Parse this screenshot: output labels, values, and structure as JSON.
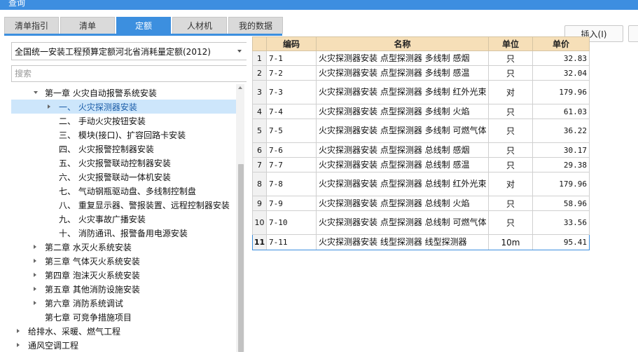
{
  "window": {
    "title": "查询"
  },
  "tabs": [
    {
      "label": "清单指引",
      "active": false
    },
    {
      "label": "清单",
      "active": false
    },
    {
      "label": "定额",
      "active": true
    },
    {
      "label": "人材机",
      "active": false
    },
    {
      "label": "我的数据",
      "active": false
    }
  ],
  "toolbar": {
    "insert_label": "插入(I)"
  },
  "left": {
    "quota_db": "全国统一安装工程预算定额河北省消耗量定额(2012)",
    "search_placeholder": "搜索",
    "tree": [
      {
        "label": "第一章  火灾自动报警系统安装",
        "level": 1,
        "arrow": "down",
        "selected": false
      },
      {
        "label": "一、 火灾探测器安装",
        "level": 2,
        "arrow": "right",
        "selected": true
      },
      {
        "label": "二、 手动火灾按钮安装",
        "level": 2,
        "arrow": "none",
        "selected": false
      },
      {
        "label": "三、 模块(接口)、扩容回路卡安装",
        "level": 2,
        "arrow": "none",
        "selected": false
      },
      {
        "label": "四、 火灾报警控制器安装",
        "level": 2,
        "arrow": "none",
        "selected": false
      },
      {
        "label": "五、 火灾报警联动控制器安装",
        "level": 2,
        "arrow": "none",
        "selected": false
      },
      {
        "label": "六、 火灾报警联动一体机安装",
        "level": 2,
        "arrow": "none",
        "selected": false
      },
      {
        "label": "七、 气动钢瓶驱动盘、多线制控制盘",
        "level": 2,
        "arrow": "none",
        "selected": false
      },
      {
        "label": "八、 重复显示器、警报装置、远程控制器安装",
        "level": 2,
        "arrow": "none",
        "selected": false
      },
      {
        "label": "九、 火灾事故广播安装",
        "level": 2,
        "arrow": "none",
        "selected": false
      },
      {
        "label": "十、 消防通讯、报警备用电源安装",
        "level": 2,
        "arrow": "none",
        "selected": false
      },
      {
        "label": "第二章  水灭火系统安装",
        "level": 1,
        "arrow": "right",
        "selected": false
      },
      {
        "label": "第三章  气体灭火系统安装",
        "level": 1,
        "arrow": "right",
        "selected": false
      },
      {
        "label": "第四章  泡沫灭火系统安装",
        "level": 1,
        "arrow": "right",
        "selected": false
      },
      {
        "label": "第五章  其他消防设施安装",
        "level": 1,
        "arrow": "right",
        "selected": false
      },
      {
        "label": "第六章  消防系统调试",
        "level": 1,
        "arrow": "right",
        "selected": false
      },
      {
        "label": "第七章  可竞争措施项目",
        "level": 1,
        "arrow": "none",
        "selected": false
      },
      {
        "label": "给排水、采暖、燃气工程",
        "level": 0,
        "arrow": "right",
        "selected": false
      },
      {
        "label": "通风空调工程",
        "level": 0,
        "arrow": "right",
        "selected": false
      }
    ]
  },
  "grid": {
    "headers": [
      "编码",
      "名称",
      "单位",
      "单价"
    ],
    "rows": [
      {
        "idx": "1",
        "code": "7-1",
        "name": "火灾探测器安装 点型探测器 多线制 感烟",
        "unit": "只",
        "price": "32.83",
        "selected": false
      },
      {
        "idx": "2",
        "code": "7-2",
        "name": "火灾探测器安装 点型探测器 多线制 感温",
        "unit": "只",
        "price": "32.04",
        "selected": false
      },
      {
        "idx": "3",
        "code": "7-3",
        "name": "火灾探测器安装 点型探测器 多线制 红外光束",
        "unit": "对",
        "price": "179.96",
        "selected": false
      },
      {
        "idx": "4",
        "code": "7-4",
        "name": "火灾探测器安装 点型探测器 多线制 火焰",
        "unit": "只",
        "price": "61.03",
        "selected": false
      },
      {
        "idx": "5",
        "code": "7-5",
        "name": "火灾探测器安装 点型探测器 多线制 可燃气体",
        "unit": "只",
        "price": "36.22",
        "selected": false
      },
      {
        "idx": "6",
        "code": "7-6",
        "name": "火灾探测器安装 点型探测器 总线制 感烟",
        "unit": "只",
        "price": "30.17",
        "selected": false
      },
      {
        "idx": "7",
        "code": "7-7",
        "name": "火灾探测器安装 点型探测器 总线制 感温",
        "unit": "只",
        "price": "29.38",
        "selected": false
      },
      {
        "idx": "8",
        "code": "7-8",
        "name": "火灾探测器安装 点型探测器 总线制 红外光束",
        "unit": "对",
        "price": "179.96",
        "selected": false
      },
      {
        "idx": "9",
        "code": "7-9",
        "name": "火灾探测器安装 点型探测器 总线制 火焰",
        "unit": "只",
        "price": "58.96",
        "selected": false
      },
      {
        "idx": "10",
        "code": "7-10",
        "name": "火灾探测器安装 点型探测器 总线制 可燃气体",
        "unit": "只",
        "price": "33.56",
        "selected": false
      },
      {
        "idx": "11",
        "code": "7-11",
        "name": "火灾探测器安装 线型探测器 线型探测器",
        "unit": "10m",
        "price": "95.41",
        "selected": true
      }
    ]
  }
}
